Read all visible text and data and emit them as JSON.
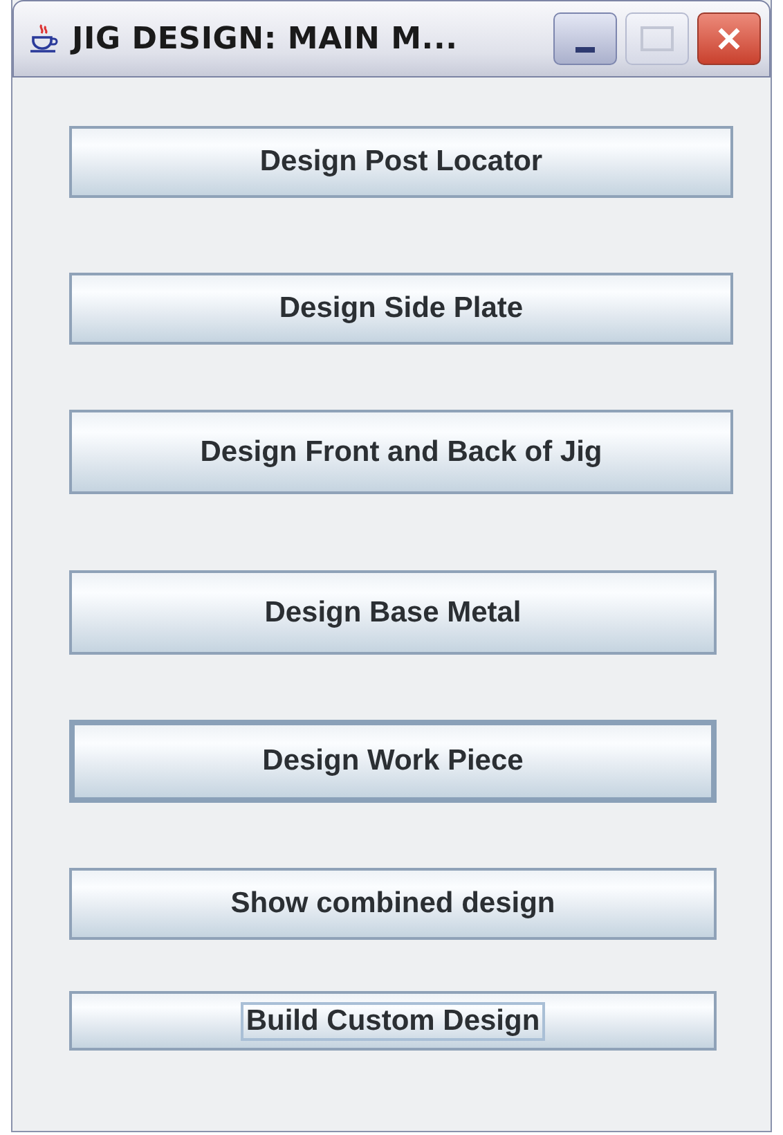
{
  "window": {
    "title": "JIG DESIGN: MAIN M..."
  },
  "buttons": [
    {
      "label": "Design Post Locator",
      "hovered": false,
      "focused": false
    },
    {
      "label": "Design Side Plate",
      "hovered": false,
      "focused": false
    },
    {
      "label": "Design Front and Back of Jig",
      "hovered": false,
      "focused": false
    },
    {
      "label": "Design Base Metal",
      "hovered": false,
      "focused": false
    },
    {
      "label": "Design Work Piece",
      "hovered": true,
      "focused": false
    },
    {
      "label": "Show combined design",
      "hovered": false,
      "focused": false
    },
    {
      "label": "Build Custom Design",
      "hovered": false,
      "focused": true
    }
  ]
}
